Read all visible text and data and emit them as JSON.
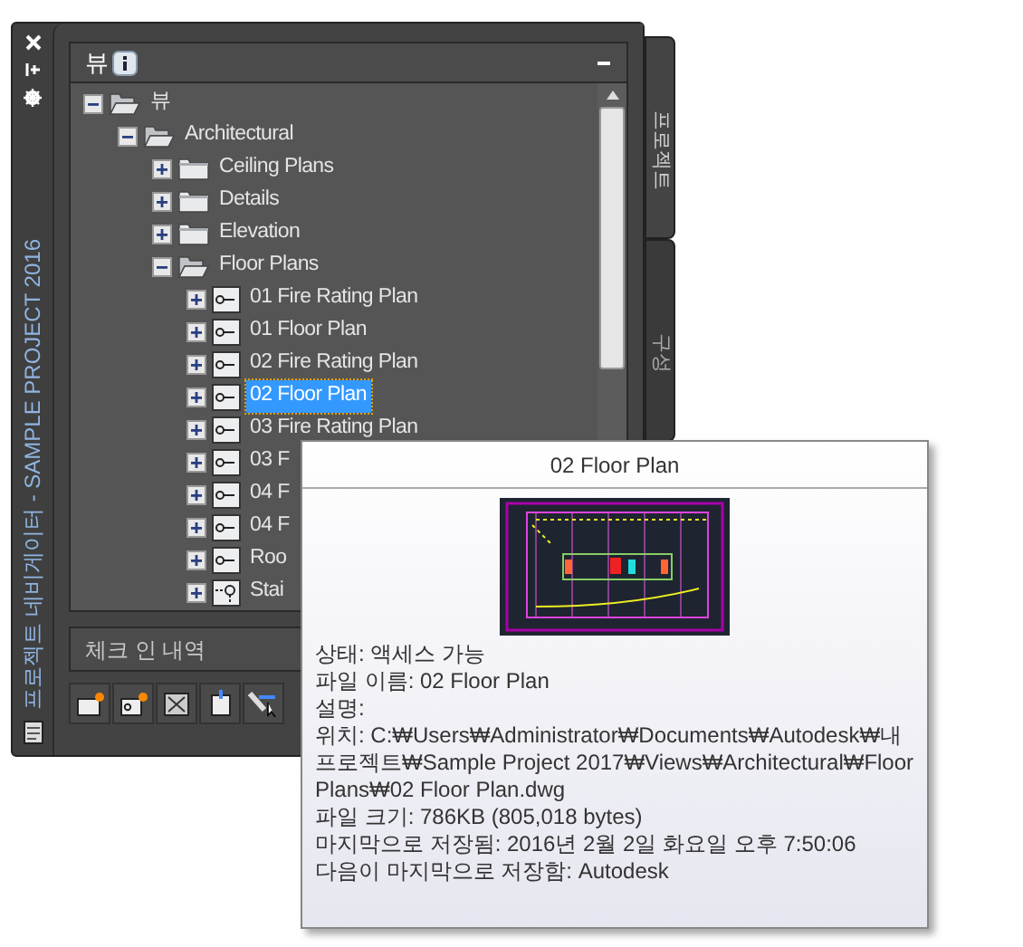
{
  "window": {
    "title": "프로젝트 네비게이터 - SAMPLE PROJECT 2016"
  },
  "side_tabs": [
    {
      "label": "프로젝트",
      "selected": true
    },
    {
      "label": "구성",
      "selected": false
    }
  ],
  "panel": {
    "title": "뷰",
    "expanded": true
  },
  "tree": [
    {
      "label": "뷰",
      "kind": "folder",
      "expanded": true,
      "selected": false,
      "children": [
        {
          "label": "Architectural",
          "kind": "folder",
          "expanded": true,
          "selected": false,
          "children": [
            {
              "label": "Ceiling Plans",
              "kind": "folder",
              "expanded": false,
              "selected": false
            },
            {
              "label": "Details",
              "kind": "folder",
              "expanded": false,
              "selected": false
            },
            {
              "label": "Elevation",
              "kind": "folder",
              "expanded": false,
              "selected": false
            },
            {
              "label": "Floor Plans",
              "kind": "folder",
              "expanded": true,
              "selected": false,
              "children": [
                {
                  "label": "01 Fire Rating Plan",
                  "kind": "view",
                  "expanded": false,
                  "selected": false
                },
                {
                  "label": "01 Floor Plan",
                  "kind": "view",
                  "expanded": false,
                  "selected": false
                },
                {
                  "label": "02 Fire Rating Plan",
                  "kind": "view",
                  "expanded": false,
                  "selected": false
                },
                {
                  "label": "02 Floor Plan",
                  "kind": "view",
                  "expanded": false,
                  "selected": true
                },
                {
                  "label": "03 Fire Rating Plan",
                  "kind": "view",
                  "expanded": false,
                  "selected": false
                },
                {
                  "label": "03 F",
                  "kind": "view",
                  "expanded": false,
                  "selected": false
                },
                {
                  "label": "04 F",
                  "kind": "view",
                  "expanded": false,
                  "selected": false
                },
                {
                  "label": "04 F",
                  "kind": "view",
                  "expanded": false,
                  "selected": false
                },
                {
                  "label": "Roo",
                  "kind": "view",
                  "expanded": false,
                  "selected": false
                },
                {
                  "label": "Stai",
                  "kind": "detail",
                  "expanded": false,
                  "selected": false
                }
              ]
            }
          ]
        }
      ]
    }
  ],
  "checkin_section": {
    "title": "체크 인 내역"
  },
  "tooltip": {
    "title": "02 Floor Plan",
    "lines": [
      "상태: 액세스 가능",
      "파일 이름: 02 Floor Plan",
      "설명:",
      "위치: C:₩Users₩Administrator₩Documents₩Autodesk₩내 프로젝트₩Sample Project 2017₩Views₩Architectural₩Floor Plans₩02 Floor Plan.dwg",
      "파일 크기: 786KB (805,018 bytes)",
      "마지막으로 저장됨: 2016년 2월 2일 화요일  오후 7:50:06",
      "다음이 마지막으로 저장함: Autodesk"
    ]
  }
}
